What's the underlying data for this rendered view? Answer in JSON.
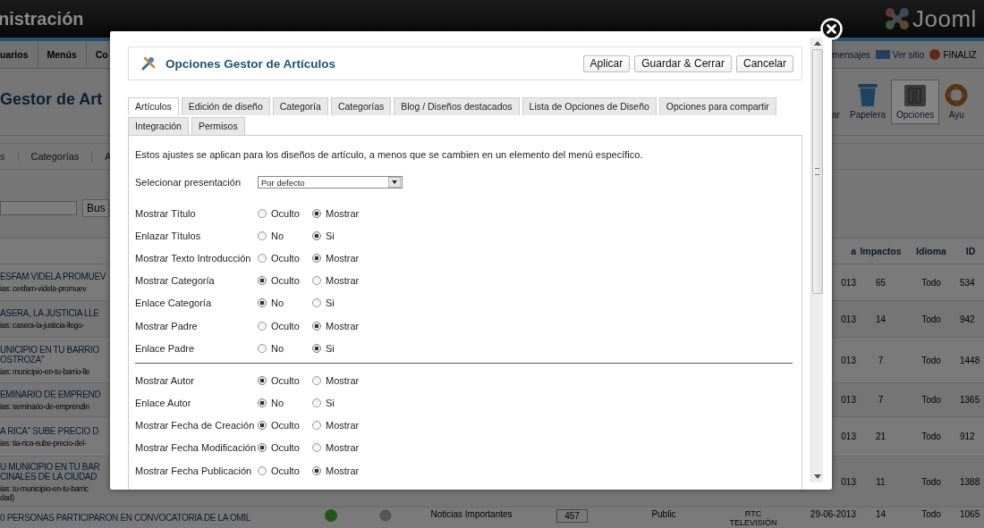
{
  "header": {
    "title": "nistración",
    "logo_text": "Jooml"
  },
  "top_menu": [
    "uarios",
    "Menús",
    "Co"
  ],
  "status_links": [
    {
      "label": "mensajes",
      "kind": "messages"
    },
    {
      "label": "Ver sitio",
      "kind": "site"
    },
    {
      "label": "FINALIZ",
      "kind": "logout"
    }
  ],
  "page_title": "Gestor de Art",
  "toolbar": [
    {
      "label": "ar",
      "kind": "cut",
      "selected": false
    },
    {
      "label": "Papelera",
      "kind": "trash",
      "selected": false
    },
    {
      "label": "Opciones",
      "kind": "options",
      "selected": true
    },
    {
      "label": "Ayu",
      "kind": "help",
      "selected": false
    }
  ],
  "submenu": [
    "s",
    "Categorías",
    "A"
  ],
  "search": {
    "button": "Bus"
  },
  "table": {
    "columns": [
      "a",
      "Impactos",
      "Idioma",
      "ID"
    ],
    "rows": [
      {
        "title": [
          "ESFAM VIDELA PROMUEV"
        ],
        "alias": [
          "ias: cesfam-videla-promuev"
        ],
        "date": "013",
        "hits": "65",
        "language": "Todo",
        "id": "534"
      },
      {
        "title": [
          "ASERA, LA JUSTICIA LLE"
        ],
        "alias": [
          "ias: casera-la-justicia-llego-"
        ],
        "date": "013",
        "hits": "14",
        "language": "Todo",
        "id": "942"
      },
      {
        "title": [
          "UNICIPIO EN TU BARRIO",
          "OSTROZA\""
        ],
        "alias": [
          "ias: municipio-en-tu-barrio-lle"
        ],
        "date": "013",
        "hits": "7",
        "language": "Todo",
        "id": "1448"
      },
      {
        "title": [
          "EMINARIO DE EMPREND"
        ],
        "alias": [
          "ias: seminario-de-emprendin"
        ],
        "date": "013",
        "hits": "7",
        "language": "Todo",
        "id": "1365"
      },
      {
        "title": [
          "A RICA\" SUBE PRECIO D"
        ],
        "alias": [
          "ias: tia-rica-sube-precio-del-"
        ],
        "date": "013",
        "hits": "21",
        "language": "Todo",
        "id": "912"
      },
      {
        "title": [
          "U MUNICIPIO EN TU BAR",
          "CINALES DE LA CIUDAD"
        ],
        "alias": [
          "ias: tu-municipio-en-tu-barric",
          "dad)"
        ],
        "date": "013",
        "hits": "11",
        "language": "Todo",
        "id": "1388"
      },
      {
        "title": [
          "0 PERSONAS PARTICIPARON EN CONVOCATORIA DE LA OMIL"
        ],
        "featured": true,
        "published": false,
        "category": "Noticias Importantes",
        "order": "457",
        "access": "Public",
        "author": "RTC TELEVISIÓN",
        "date": "29-06-2013",
        "hits": "14",
        "language": "Todo",
        "id": "1065"
      }
    ]
  },
  "modal": {
    "title": "Opciones Gestor de Artículos",
    "buttons": [
      "Aplicar",
      "Guardar & Cerrar",
      "Cancelar"
    ],
    "tabs": [
      {
        "label": "Artículos",
        "selected": true
      },
      {
        "label": "Edición de diseño",
        "selected": false
      },
      {
        "label": "Categoría",
        "selected": false
      },
      {
        "label": "Categorías",
        "selected": false
      },
      {
        "label": "Blog / Diseños destacados",
        "selected": false
      },
      {
        "label": "Lista de Opciones de Diseño",
        "selected": false
      },
      {
        "label": "Opciones para compartir",
        "selected": false
      },
      {
        "label": "Integración",
        "selected": false
      },
      {
        "label": "Permisos",
        "selected": false
      }
    ],
    "intro": "Estos ajustes se aplican para los diseños de artículo, a menos que se cambien en un elemento del menú específico.",
    "form": [
      {
        "kind": "select",
        "label": "Selecionar presentación",
        "value": "Por defecto"
      },
      {
        "kind": "radio",
        "label": "Mostrar Título",
        "options": [
          {
            "label": "Oculto",
            "selected": false
          },
          {
            "label": "Mostrar",
            "selected": true
          }
        ]
      },
      {
        "kind": "radio",
        "label": "Enlazar Títulos",
        "options": [
          {
            "label": "No",
            "selected": false
          },
          {
            "label": "Si",
            "selected": true
          }
        ]
      },
      {
        "kind": "radio",
        "label": "Mostrar Texto Introducción",
        "options": [
          {
            "label": "Oculto",
            "selected": false
          },
          {
            "label": "Mostrar",
            "selected": true
          }
        ]
      },
      {
        "kind": "radio",
        "label": "Mostrar Categoría",
        "options": [
          {
            "label": "Oculto",
            "selected": true
          },
          {
            "label": "Mostrar",
            "selected": false
          }
        ]
      },
      {
        "kind": "radio",
        "label": "Enlace Categoría",
        "options": [
          {
            "label": "No",
            "selected": true
          },
          {
            "label": "Si",
            "selected": false
          }
        ]
      },
      {
        "kind": "radio",
        "label": "Mostrar Padre",
        "options": [
          {
            "label": "Oculto",
            "selected": false
          },
          {
            "label": "Mostrar",
            "selected": true
          }
        ]
      },
      {
        "kind": "radio",
        "label": "Enlace Padre",
        "options": [
          {
            "label": "No",
            "selected": false
          },
          {
            "label": "Si",
            "selected": true
          }
        ]
      },
      {
        "kind": "separator"
      },
      {
        "kind": "radio",
        "label": "Mostrar Autor",
        "options": [
          {
            "label": "Oculto",
            "selected": true
          },
          {
            "label": "Mostrar",
            "selected": false
          }
        ]
      },
      {
        "kind": "radio",
        "label": "Enlace Autor",
        "options": [
          {
            "label": "No",
            "selected": true
          },
          {
            "label": "Si",
            "selected": false
          }
        ]
      },
      {
        "kind": "radio",
        "label": "Mostrar Fecha de Creación",
        "options": [
          {
            "label": "Oculto",
            "selected": true
          },
          {
            "label": "Mostrar",
            "selected": false
          }
        ]
      },
      {
        "kind": "radio",
        "label": "Mostrar Fecha Modificación",
        "options": [
          {
            "label": "Oculto",
            "selected": true
          },
          {
            "label": "Mostrar",
            "selected": false
          }
        ]
      },
      {
        "kind": "radio",
        "label": "Mostrar Fecha Publicación",
        "options": [
          {
            "label": "Oculto",
            "selected": false
          },
          {
            "label": "Mostrar",
            "selected": true
          }
        ]
      }
    ]
  }
}
